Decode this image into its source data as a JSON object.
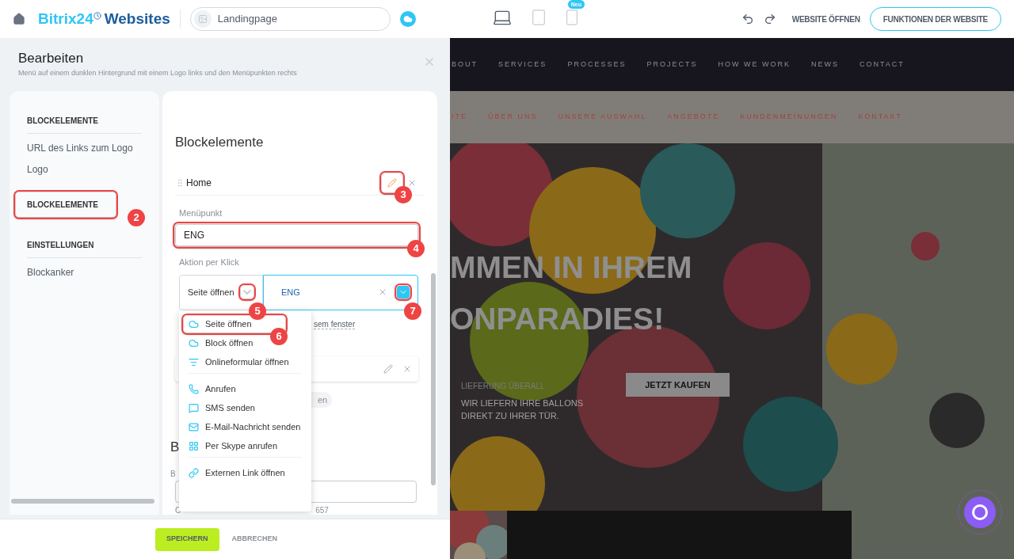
{
  "topbar": {
    "brand": "Bitrix24",
    "brand_suffix": "Websites",
    "site_field": {
      "value": "Landingpage"
    },
    "devices": [
      {
        "kind": "desktop",
        "selected": true
      },
      {
        "kind": "tablet",
        "selected": false
      },
      {
        "kind": "phone",
        "selected": false,
        "badge": "Neu"
      }
    ],
    "open_site": "WEBSITE ÖFFNEN",
    "features_button": "FUNKTIONEN DER WEBSITE"
  },
  "editor": {
    "title": "Bearbeiten",
    "subtitle": "Menü auf einem dunklen Hintergrund mit einem Logo links und den Menüpunkten rechts",
    "sidebar": [
      {
        "heading": "BLOCKELEMENTE",
        "items": [
          "URL des Links zum Logo",
          "Logo"
        ]
      },
      {
        "heading": "BLOCKELEMENTE",
        "callout": "2"
      },
      {
        "heading": "EINSTELLUNGEN",
        "items": [
          "Blockanker"
        ]
      }
    ],
    "form": {
      "heading": "Blockelemente",
      "item_title": "Home",
      "edit_callout": "3",
      "name_label": "Menüpunkt",
      "name_value": "ENG",
      "name_callout": "4",
      "action_label": "Aktion per Klick",
      "action_type": "Seite öffnen",
      "action_type_callout": "5",
      "action_target": "ENG",
      "action_target_callout": "7",
      "window_link": "sem fenster",
      "pill": "en",
      "section_heading": "B",
      "field_label": "B",
      "hint_start": "C",
      "hint_end": "657"
    },
    "dropdown": {
      "groups": [
        [
          {
            "kind": "page",
            "label": "Seite öffnen",
            "callout": "6"
          },
          {
            "kind": "block",
            "label": "Block öffnen"
          },
          {
            "kind": "form",
            "label": "Onlineformular öffnen"
          }
        ],
        [
          {
            "kind": "call",
            "label": "Anrufen"
          },
          {
            "kind": "sms",
            "label": "SMS senden"
          },
          {
            "kind": "email",
            "label": "E-Mail-Nachricht senden"
          },
          {
            "kind": "skype",
            "label": "Per Skype anrufen"
          }
        ],
        [
          {
            "kind": "link",
            "label": "Externen Link öffnen"
          }
        ]
      ]
    },
    "footer": {
      "save": "SPEICHERN",
      "cancel": "ABBRECHEN"
    }
  },
  "preview": {
    "nav": [
      "BOUT",
      "SERVICES",
      "PROCESSES",
      "PROJECTS",
      "HOW WE WORK",
      "NEWS",
      "CONTACT"
    ],
    "subnav": [
      "ITE",
      "ÜBER UNS",
      "UNSERE AUSWAHL",
      "ANGEBOTE",
      "KUNDENMEINUNGEN",
      "KONTAKT"
    ],
    "headline": [
      "MMEN IN IHREM",
      "ONPARADIES!"
    ],
    "eyebrow": "LIEFERUNG ÜBERALL",
    "text": "WIR LIEFERN IHRE BALLONS DIREKT ZU IHRER TÜR.",
    "button": "JETZT KAUFEN"
  }
}
